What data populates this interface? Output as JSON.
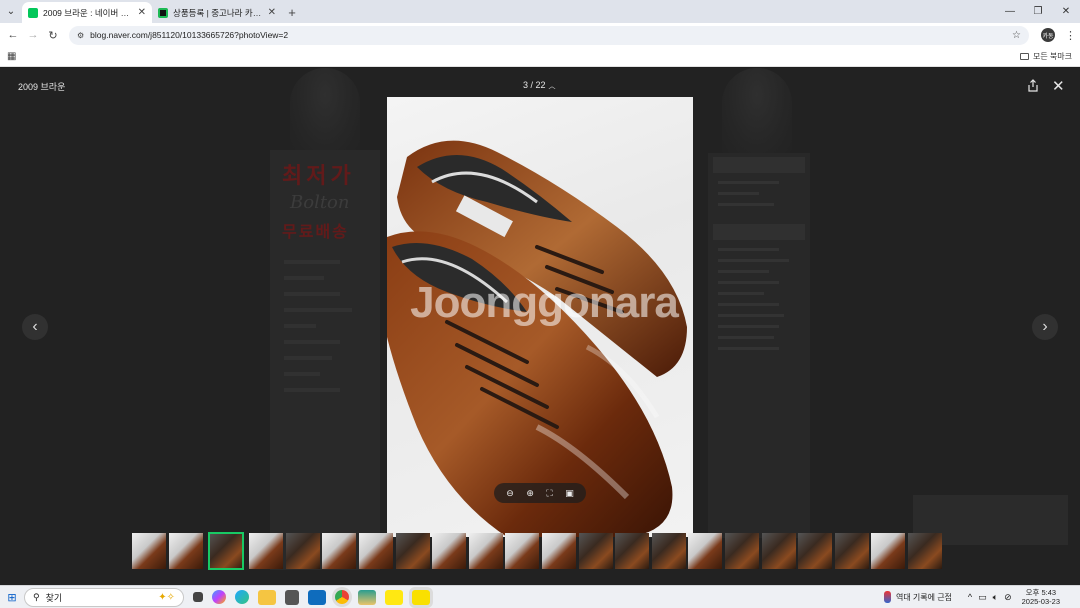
{
  "browser": {
    "tabs": [
      {
        "label": "2009 브라운 : 네이버 블로그",
        "favicon_color": "#03c75a",
        "active": true
      },
      {
        "label": "상품등록 | 중고나라 카페에서",
        "favicon_color": "#111111",
        "active": false
      }
    ],
    "url": "blog.naver.com/j851120/10133665726?photoView=2",
    "profile_initials": "카동",
    "all_bookmarks_label": "모든 북마크"
  },
  "viewer": {
    "title": "2009 브라운",
    "counter": "3 / 22",
    "watermark": "Joonggonara",
    "background_text": {
      "banner_line1": "최저가",
      "banner_line2": "Bolton",
      "banner_line3": "무료배송"
    },
    "selected_thumbnail_index": 2,
    "thumbnail_count": 22,
    "accent_color": "#18c964"
  },
  "taskbar": {
    "search_placeholder": "찾기",
    "weather_text": "역대 기록에 근접",
    "time": "오후 5:43",
    "date": "2025-03-23"
  }
}
